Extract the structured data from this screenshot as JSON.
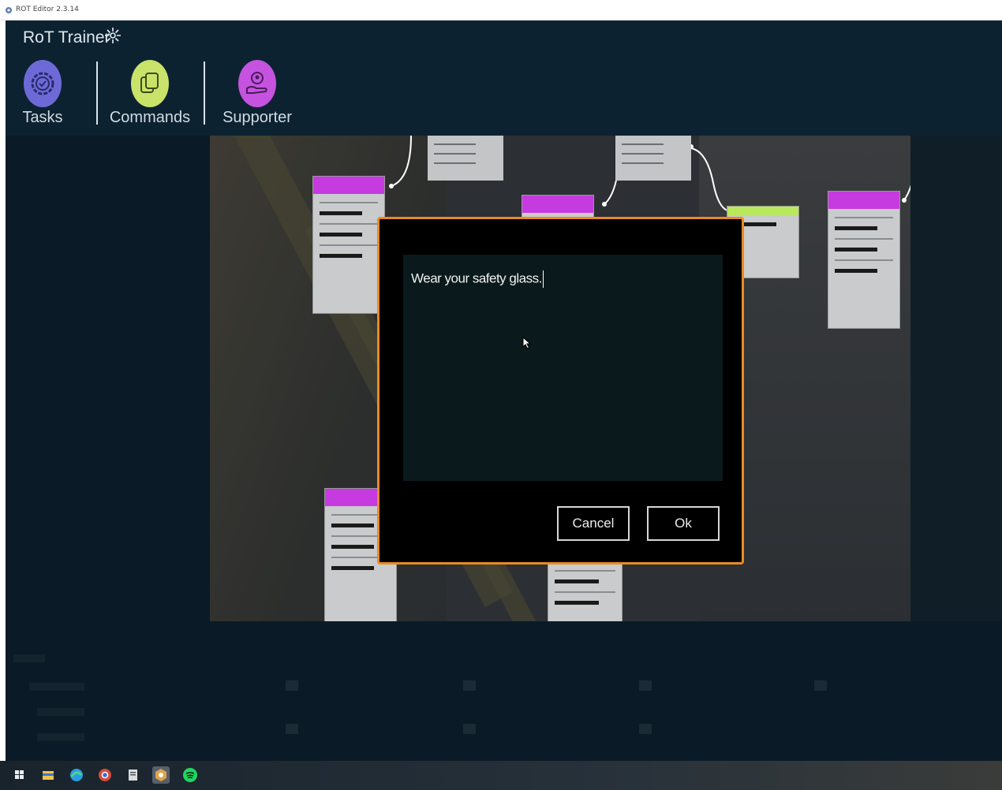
{
  "window": {
    "title": "ROT Editor 2.3.14"
  },
  "app": {
    "title": "RoT Trainer",
    "logo_icon": "gear-flower-icon"
  },
  "nav": [
    {
      "id": "tasks",
      "label": "Tasks",
      "icon": "gear-check-icon",
      "color": "#6d6ad8"
    },
    {
      "id": "commands",
      "label": "Commands",
      "icon": "copy-pages-icon",
      "color": "#c9e26a"
    },
    {
      "id": "supporter",
      "label": "Supporter",
      "icon": "hand-person-icon",
      "color": "#c553e0"
    }
  ],
  "dialog": {
    "text_value": "Wear your safety glass.",
    "cancel_label": "Cancel",
    "ok_label": "Ok",
    "border_color": "#e98a25"
  },
  "taskbar": {
    "icons": [
      "windows-start-icon",
      "file-explorer-icon",
      "edge-browser-icon",
      "chrome-icon",
      "notepad-icon",
      "rot-editor-icon",
      "spotify-icon"
    ],
    "active_icon": "rot-editor-icon"
  },
  "colors": {
    "app_bg": "#0a1a26",
    "header_bg": "#0d2231",
    "node_accent": "#c53be0",
    "animation_accent": "#b9e85c"
  }
}
